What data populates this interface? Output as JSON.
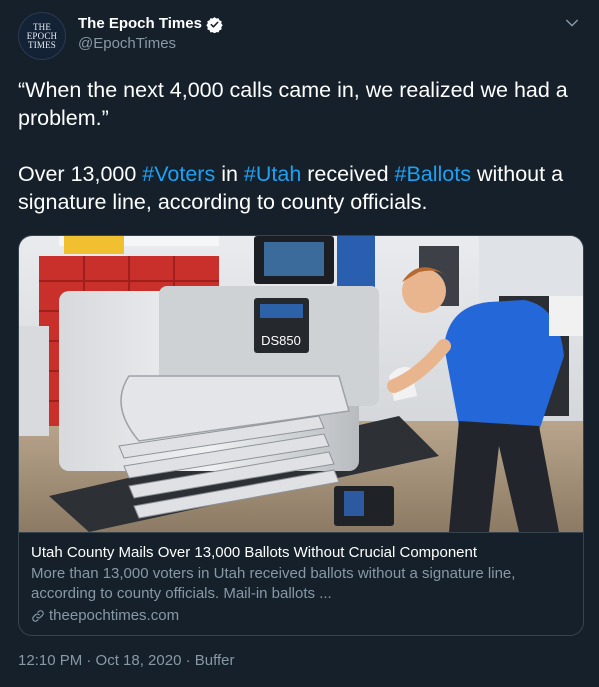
{
  "author": {
    "avatar_text": [
      "THE",
      "EPOCH",
      "TIMES"
    ],
    "display_name": "The Epoch Times",
    "handle": "@EpochTimes"
  },
  "tweet": {
    "paragraph1": "“When the next 4,000 calls came in, we realized we had a problem.”",
    "p2_a": "Over 13,000 ",
    "p2_hashtag1": "#Voters",
    "p2_b": " in ",
    "p2_hashtag2": "#Utah",
    "p2_c": " received ",
    "p2_hashtag3": "#Ballots",
    "p2_d": " without a signature line, according to county officials."
  },
  "card": {
    "machine_label": "DS850",
    "title": "Utah County Mails Over 13,000 Ballots Without Crucial Component",
    "description": "More than 13,000 voters in Utah received ballots without a signature line, according to county officials. Mail-in ballots ...",
    "domain": "theepochtimes.com"
  },
  "meta": {
    "timestamp": "12:10 PM · Oct 18, 2020 · Buffer"
  },
  "colors": {
    "background": "#15202b",
    "accent": "#1da1f2",
    "secondary_text": "#8899a6",
    "border": "#38444d"
  },
  "icons": [
    "verified-icon",
    "chevron-down-icon",
    "link-icon"
  ]
}
